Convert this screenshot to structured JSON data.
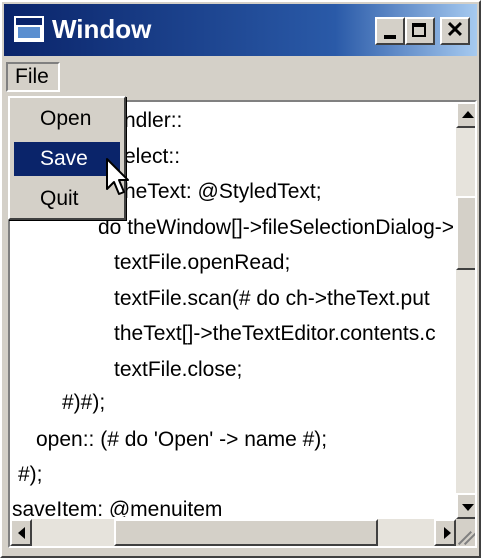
{
  "window": {
    "title": "Window"
  },
  "menubar": {
    "file": "File"
  },
  "file_menu": {
    "items": [
      {
        "label": "Open",
        "selected": false
      },
      {
        "label": "Save",
        "selected": true
      },
      {
        "label": "Quit",
        "selected": false
      }
    ]
  },
  "editor": {
    "visible_code": [
      "ndler::",
      "elect::",
      "heText: @StyledText;",
      "do theWindow[]->fileSelectionDialog->",
      "textFile.openRead;",
      "textFile.scan(# do ch->theText.put",
      "theText[]->theTextEditor.contents.c",
      "textFile.close;",
      "#)#);",
      "open:: (# do 'Open' -> name #);",
      "#);",
      "saveItem: @menuitem"
    ]
  },
  "colors": {
    "title_active": "#0a246a",
    "title_gradient_end": "#a6caf0",
    "chrome": "#d4d0c8",
    "menu_highlight": "#0a246a"
  },
  "icons": [
    "window-app-icon",
    "minimize-icon",
    "maximize-icon",
    "close-icon",
    "scroll-up-icon",
    "scroll-down-icon",
    "scroll-left-icon",
    "scroll-right-icon",
    "resize-grip-icon",
    "mouse-pointer-icon"
  ]
}
